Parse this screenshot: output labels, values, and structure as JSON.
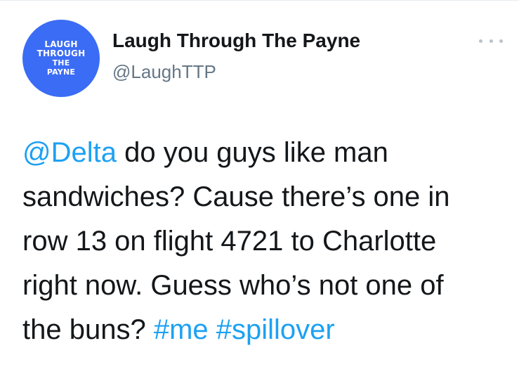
{
  "author": {
    "avatar_lines": [
      "LAUGH",
      "THROUGH",
      "THE",
      "PAYNE"
    ],
    "display_name": "Laugh Through The Payne",
    "handle": "@LaughTTP"
  },
  "tweet": {
    "mention": "@Delta",
    "line1_rest": " do you guys like man",
    "line2": "sandwiches? Cause there’s one in",
    "line3": "row 13 on flight 4721 to Charlotte",
    "line4": "right now. Guess who’s not one of",
    "line5_text": "the buns? ",
    "hashtag1": "#me",
    "hashtag_sep": " ",
    "hashtag2": "#spillover"
  },
  "colors": {
    "avatar_bg": "#3b6cf5",
    "link": "#1da1f2",
    "text": "#14171a",
    "secondary": "#657786"
  },
  "icons": {
    "more": "more-horizontal-icon"
  }
}
